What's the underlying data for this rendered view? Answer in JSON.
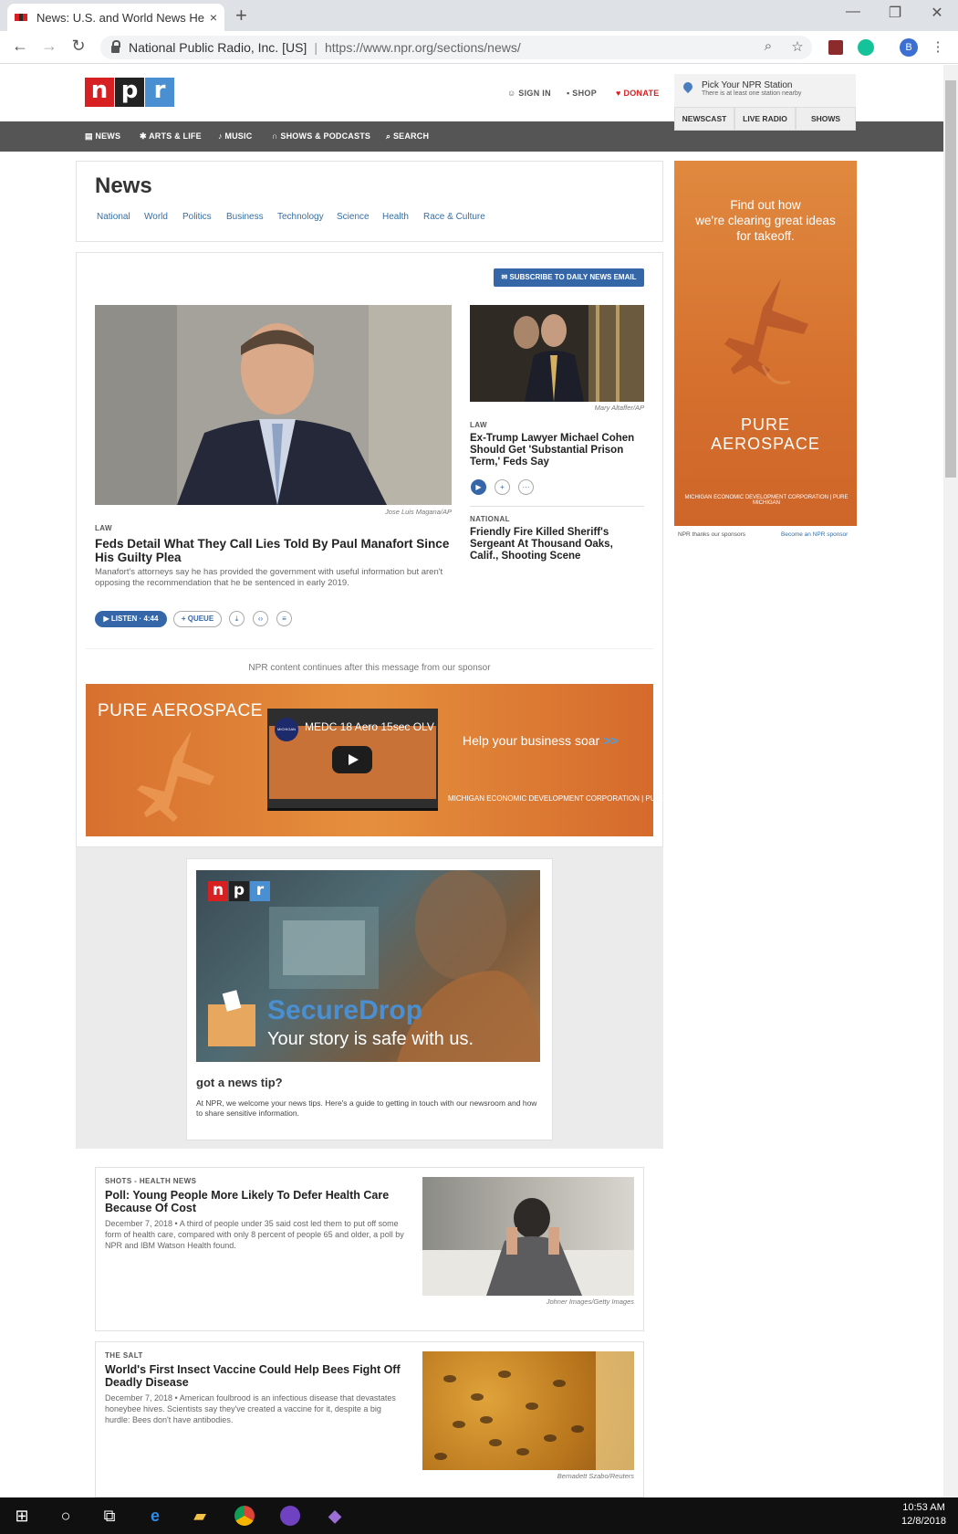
{
  "browser": {
    "tab_title": "News: U.S. and World News Head",
    "tab_close": "×",
    "new_tab": "+",
    "win_min": "—",
    "win_max": "❐",
    "win_close": "✕",
    "back": "←",
    "forward": "→",
    "reload": "↻",
    "site_identity": "National Public Radio, Inc. [US]",
    "url_host": "https://www.npr.org",
    "url_path": "/sections/news/",
    "search_icon": "⌕",
    "star_icon": "☆",
    "menu_icon": "⋮",
    "profile_initial": "B"
  },
  "npr_header": {
    "logo": [
      "n",
      "p",
      "r"
    ],
    "sign_in": "SIGN IN",
    "shop": "SHOP",
    "donate": "DONATE",
    "station_title": "Pick Your NPR Station",
    "station_sub": "There is at least one station nearby",
    "station_buttons": [
      "NEWSCAST",
      "LIVE RADIO",
      "SHOWS"
    ],
    "nav": [
      "NEWS",
      "ARTS & LIFE",
      "MUSIC",
      "SHOWS & PODCASTS",
      "SEARCH"
    ]
  },
  "section": {
    "title": "News",
    "subnav": [
      "National",
      "World",
      "Politics",
      "Business",
      "Technology",
      "Science",
      "Health",
      "Race & Culture"
    ]
  },
  "main": {
    "subscribe": "SUBSCRIBE TO DAILY NEWS EMAIL",
    "lead": {
      "credit": "Jose Luis Magana/AP",
      "slug": "LAW",
      "headline": "Feds Detail What They Call Lies Told By Paul Manafort Since His Guilty Plea",
      "teaser": "Manafort's attorneys say he has provided the government with useful information but aren't opposing the recommendation that he be sentenced in early 2019.",
      "listen": "▶  LISTEN · 4:44",
      "queue": "+ QUEUE"
    },
    "side1": {
      "credit": "Mary Altaffer/AP",
      "slug": "LAW",
      "headline": "Ex-Trump Lawyer Michael Cohen Should Get 'Substantial Prison Term,' Feds Say"
    },
    "side2": {
      "slug": "NATIONAL",
      "headline": "Friendly Fire Killed Sheriff's Sergeant At Thousand Oaks, Calif., Shooting Scene"
    },
    "sponsor_note": "NPR content continues after this message from our sponsor"
  },
  "banner_ad": {
    "title": "PURE AEROSPACE",
    "video_title": "MEDC 18 Aero 15sec OLV",
    "help": "Help your business soar",
    "arrows": ">>",
    "footer": "MICHIGAN ECONOMIC DEVELOPMENT CORPORATION  |  PURE MICHIGAN"
  },
  "securedrop": {
    "logo": [
      "n",
      "p",
      "r"
    ],
    "title": "SecureDrop",
    "subtitle": "Your story is safe with us.",
    "question": "got a news tip?",
    "text": "At NPR, we welcome your news tips. Here's a guide to getting in touch with our newsroom and how to share sensitive information."
  },
  "stories": [
    {
      "slug": "SHOTS - HEALTH NEWS",
      "headline": "Poll: Young People More Likely To Defer Health Care Because Of Cost",
      "teaser": "December 7, 2018 • A third of people under 35 said cost led them to put off some form of health care, compared with only 8 percent of people 65 and older, a poll by NPR and IBM Watson Health found.",
      "credit": "Johner Images/Getty Images"
    },
    {
      "slug": "THE SALT",
      "headline": "World's First Insect Vaccine Could Help Bees Fight Off Deadly Disease",
      "teaser": "December 7, 2018 • American foulbrood is an infectious disease that devastates honeybee hives. Scientists say they've created a vaccine for it, despite a big hurdle: Bees don't have antibodies.",
      "credit": "Bernadett Szabo/Reuters"
    }
  ],
  "right_ad": {
    "line1": "Find out how",
    "line2": "we're clearing great ideas",
    "line3": "for takeoff.",
    "brand1": "PURE",
    "brand2": "AEROSPACE",
    "footer": "MICHIGAN ECONOMIC DEVELOPMENT CORPORATION  |  PURE MICHIGAN",
    "thanks": "NPR thanks our sponsors",
    "become": "Become an NPR sponsor"
  },
  "taskbar": {
    "time": "10:53 AM",
    "date": "12/8/2018"
  },
  "colors": {
    "npr_red": "#d62021",
    "npr_blue": "#4a8fd1",
    "link_blue": "#336ea8",
    "ad_orange": "#e58f3d"
  }
}
